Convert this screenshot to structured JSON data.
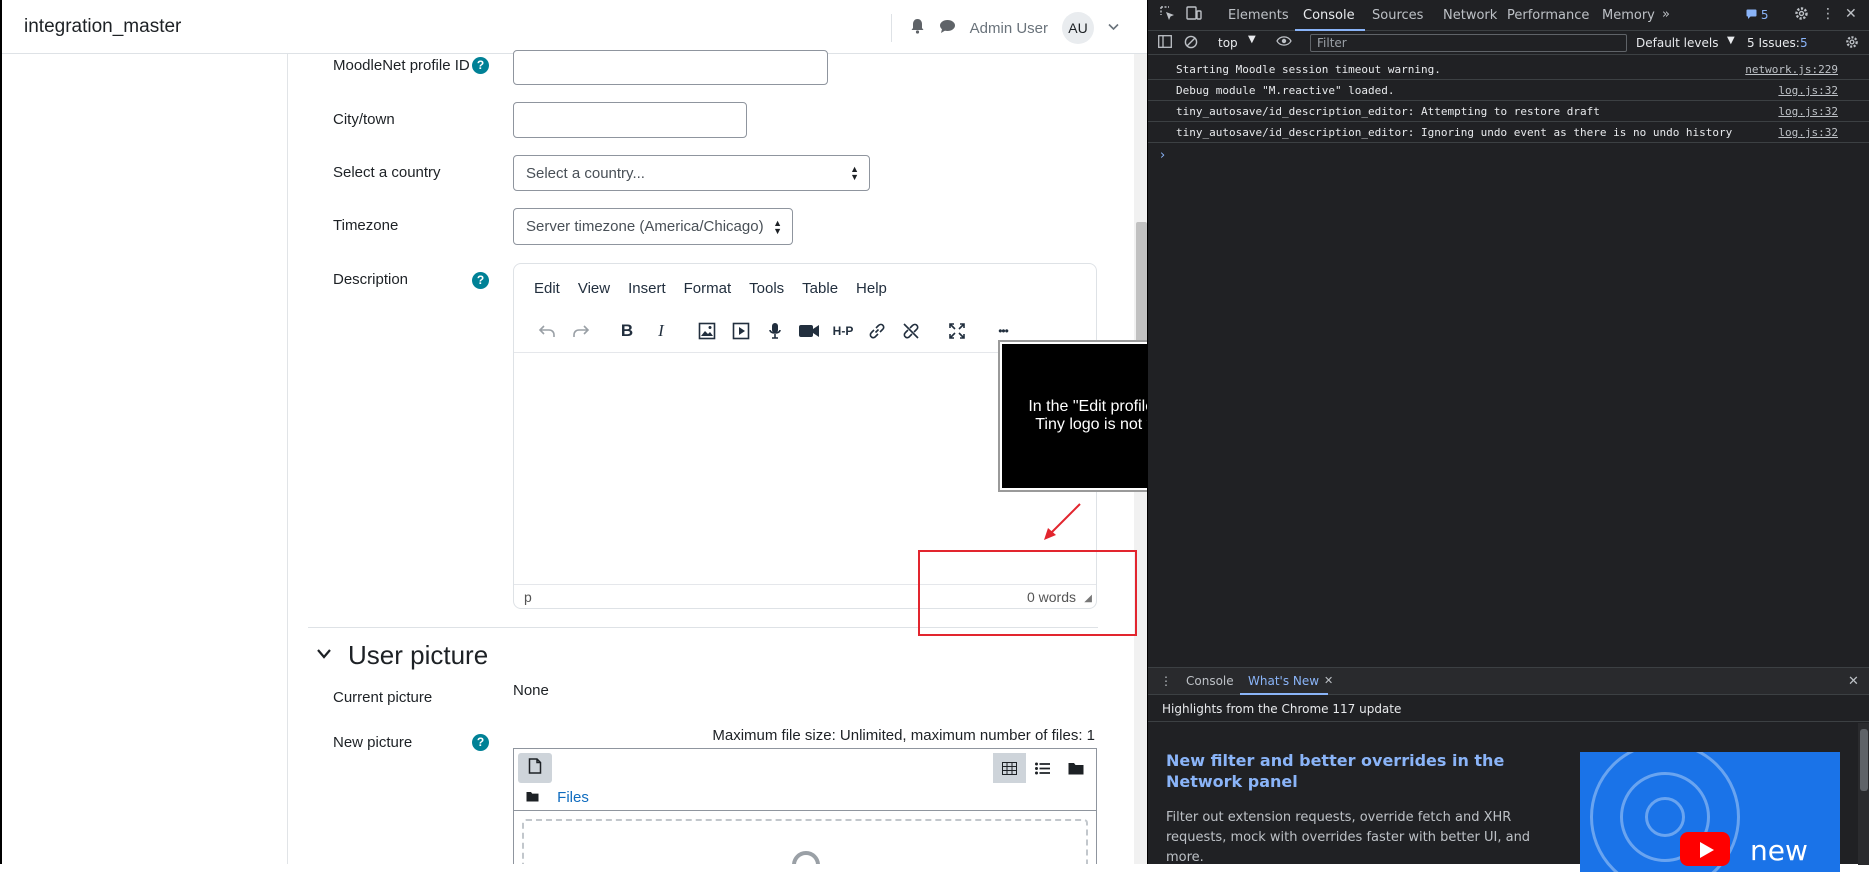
{
  "navbar": {
    "site_name": "integration_master",
    "user_name": "Admin User",
    "avatar_initials": "AU"
  },
  "form": {
    "moodlenet_label": "MoodleNet profile ID",
    "city_label": "City/town",
    "country_label": "Select a country",
    "country_value": "Select a country...",
    "timezone_label": "Timezone",
    "timezone_value": "Server timezone (America/Chicago)",
    "description_label": "Description",
    "help_glyph": "?"
  },
  "editor": {
    "menu": [
      "Edit",
      "View",
      "Insert",
      "Format",
      "Tools",
      "Table",
      "Help"
    ],
    "status_path": "p",
    "word_count": "0 words",
    "toolbar_icons": [
      "undo-icon",
      "redo-icon",
      "bold-icon",
      "italic-icon",
      "image-icon",
      "media-icon",
      "microphone-icon",
      "video-camera-icon",
      "h5p-icon",
      "link-icon",
      "unlink-icon",
      "fullscreen-icon",
      "more-icon"
    ],
    "bold_glyph": "B",
    "italic_glyph": "I",
    "h5p_glyph": "H-P",
    "more_glyph": "•••"
  },
  "user_picture": {
    "section_title": "User picture",
    "current_picture_label": "Current picture",
    "current_picture_value": "None",
    "new_picture_label": "New picture",
    "file_info": "Maximum file size: Unlimited, maximum number of files: 1",
    "files_link": "Files"
  },
  "overlay": {
    "message": "In the \"Edit profile\" page, verify the Tiny logo is not visible any more.",
    "highlight_color": "#e2252e"
  },
  "devtools": {
    "tabs": [
      "Elements",
      "Console",
      "Sources",
      "Network",
      "Performance",
      "Memory"
    ],
    "active_tab": "Console",
    "issues_badge": "5",
    "context": "top",
    "filter_placeholder": "Filter",
    "levels": "Default levels",
    "issues_label": "5 Issues:",
    "issues_count": "5",
    "logs": [
      {
        "message": "Starting Moodle session timeout warning.",
        "source": "network.js:229"
      },
      {
        "message": "Debug module \"M.reactive\" loaded.",
        "source": "log.js:32"
      },
      {
        "message": "tiny_autosave/id_description_editor: Attempting to restore draft",
        "source": "log.js:32"
      },
      {
        "message": "tiny_autosave/id_description_editor: Ignoring undo event as there is no undo history",
        "source": "log.js:32"
      }
    ],
    "drawer": {
      "tabs": [
        "Console",
        "What's New"
      ],
      "active_tab": "What's New",
      "subtitle": "Highlights from the Chrome 117 update",
      "article_title": "New filter and better overrides in the Network panel",
      "article_body": "Filter out extension requests, override fetch and XHR requests, mock with overrides faster with better UI, and more.",
      "thumb_text": "new"
    }
  }
}
